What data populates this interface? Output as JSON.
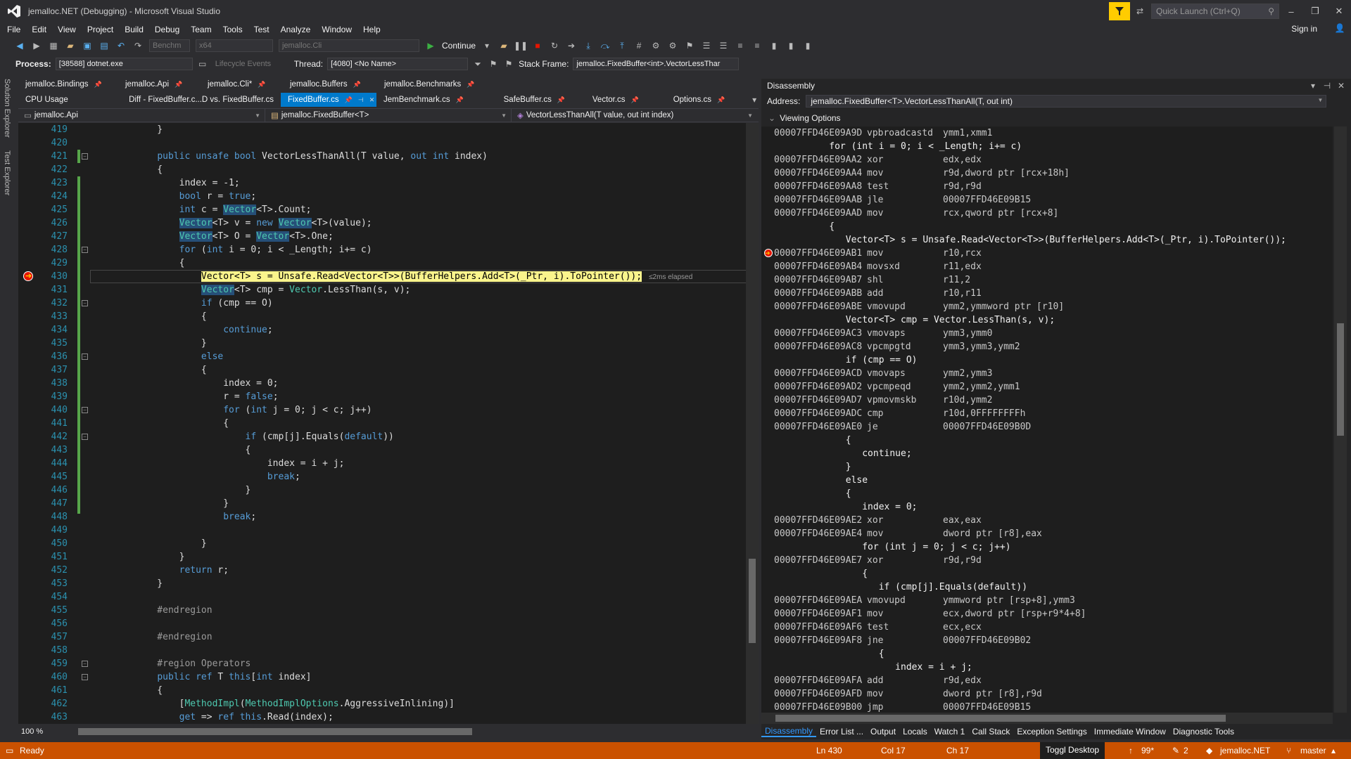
{
  "window": {
    "title": "jemalloc.NET (Debugging) - Microsoft Visual Studio",
    "quick_launch": "Quick Launch (Ctrl+Q)",
    "sign_in": "Sign in"
  },
  "menu": [
    "File",
    "Edit",
    "View",
    "Project",
    "Build",
    "Debug",
    "Team",
    "Tools",
    "Test",
    "Analyze",
    "Window",
    "Help"
  ],
  "toolbar": {
    "config": "Benchm",
    "platform": "x64",
    "startup_project": "jemalloc.Cli",
    "continue_label": "Continue"
  },
  "debug_location": {
    "process_label": "Process:",
    "process_value": "[38588] dotnet.exe",
    "lifecycle": "Lifecycle Events",
    "thread_label": "Thread:",
    "thread_value": "[4080] <No Name>",
    "stack_label": "Stack Frame:",
    "stack_value": "jemalloc.FixedBuffer<int>.VectorLessThar"
  },
  "side_tabs": [
    "Solution Explorer",
    "Test Explorer"
  ],
  "tabs_row1": [
    "jemalloc.Bindings",
    "jemalloc.Api",
    "jemalloc.Cli*",
    "jemalloc.Buffers",
    "jemalloc.Benchmarks"
  ],
  "tabs_row2": [
    "CPU Usage",
    "Diff - FixedBuffer.c...D vs. FixedBuffer.cs",
    "FixedBuffer.cs",
    "JemBenchmark.cs",
    "SafeBuffer.cs",
    "Vector.cs",
    "Options.cs"
  ],
  "nav": {
    "project": "jemalloc.Api",
    "type": "jemalloc.FixedBuffer<T>",
    "member": "VectorLessThanAll(T value, out int index)"
  },
  "editor": {
    "current_line": 430,
    "elapsed": "≤2ms elapsed",
    "zoom": "100 %",
    "lines": [
      {
        "n": "419",
        "t": "    }"
      },
      {
        "n": "420",
        "t": ""
      },
      {
        "n": "421",
        "t": "    public unsafe bool VectorLessThanAll(T value, out int index)"
      },
      {
        "n": "422",
        "t": "    {"
      },
      {
        "n": "423",
        "t": "        index = -1;"
      },
      {
        "n": "424",
        "t": "        bool r = true;"
      },
      {
        "n": "425",
        "t": "        int c = Vector<T>.Count;"
      },
      {
        "n": "426",
        "t": "        Vector<T> v = new Vector<T>(value);"
      },
      {
        "n": "427",
        "t": "        Vector<T> O = Vector<T>.One;"
      },
      {
        "n": "428",
        "t": "        for (int i = 0; i < _Length; i+= c)"
      },
      {
        "n": "429",
        "t": "        {"
      },
      {
        "n": "430",
        "t": "            Vector<T> s = Unsafe.Read<Vector<T>>(BufferHelpers.Add<T>(_Ptr, i).ToPointer());"
      },
      {
        "n": "431",
        "t": "            Vector<T> cmp = Vector.LessThan(s, v);"
      },
      {
        "n": "432",
        "t": "            if (cmp == O)"
      },
      {
        "n": "433",
        "t": "            {"
      },
      {
        "n": "434",
        "t": "                continue;"
      },
      {
        "n": "435",
        "t": "            }"
      },
      {
        "n": "436",
        "t": "            else"
      },
      {
        "n": "437",
        "t": "            {"
      },
      {
        "n": "438",
        "t": "                index = 0;"
      },
      {
        "n": "439",
        "t": "                r = false;"
      },
      {
        "n": "440",
        "t": "                for (int j = 0; j < c; j++)"
      },
      {
        "n": "441",
        "t": "                {"
      },
      {
        "n": "442",
        "t": "                    if (cmp[j].Equals(default))"
      },
      {
        "n": "443",
        "t": "                    {"
      },
      {
        "n": "444",
        "t": "                        index = i + j;"
      },
      {
        "n": "445",
        "t": "                        break;"
      },
      {
        "n": "446",
        "t": "                    }"
      },
      {
        "n": "447",
        "t": "                }"
      },
      {
        "n": "448",
        "t": "                break;"
      },
      {
        "n": "449",
        "t": ""
      },
      {
        "n": "450",
        "t": "            }"
      },
      {
        "n": "451",
        "t": "        }"
      },
      {
        "n": "452",
        "t": "        return r;"
      },
      {
        "n": "453",
        "t": "    }"
      },
      {
        "n": "454",
        "t": ""
      },
      {
        "n": "455",
        "t": "    #endregion"
      },
      {
        "n": "456",
        "t": ""
      },
      {
        "n": "457",
        "t": "    #endregion"
      },
      {
        "n": "458",
        "t": ""
      },
      {
        "n": "459",
        "t": "    #region Operators"
      },
      {
        "n": "460",
        "t": "    public ref T this[int index]"
      },
      {
        "n": "461",
        "t": "    {"
      },
      {
        "n": "462",
        "t": "        [MethodImpl(MethodImplOptions.AggressiveInlining)]"
      },
      {
        "n": "463",
        "t": "        get => ref this.Read(index);"
      }
    ]
  },
  "disassembly": {
    "panel_title": "Disassembly",
    "address_label": "Address:",
    "address_value": "jemalloc.FixedBuffer<T>.VectorLessThanAll(T, out int)",
    "viewing_options": "Viewing Options",
    "lines": [
      {
        "a": "00007FFD46E09A9D",
        "m": "vpbroadcastd",
        "o": "ymm1,xmm1"
      },
      {
        "s": "          for (int i = 0; i < _Length; i+= c)"
      },
      {
        "a": "00007FFD46E09AA2",
        "m": "xor",
        "o": "edx,edx"
      },
      {
        "a": "00007FFD46E09AA4",
        "m": "mov",
        "o": "r9d,dword ptr [rcx+18h]"
      },
      {
        "a": "00007FFD46E09AA8",
        "m": "test",
        "o": "r9d,r9d"
      },
      {
        "a": "00007FFD46E09AAB",
        "m": "jle",
        "o": "00007FFD46E09B15"
      },
      {
        "a": "00007FFD46E09AAD",
        "m": "mov",
        "o": "rcx,qword ptr [rcx+8]"
      },
      {
        "s": "          {"
      },
      {
        "s": "             Vector<T> s = Unsafe.Read<Vector<T>>(BufferHelpers.Add<T>(_Ptr, i).ToPointer());"
      },
      {
        "a": "00007FFD46E09AB1",
        "m": "mov",
        "o": "r10,rcx"
      },
      {
        "a": "00007FFD46E09AB4",
        "m": "movsxd",
        "o": "r11,edx"
      },
      {
        "a": "00007FFD46E09AB7",
        "m": "shl",
        "o": "r11,2"
      },
      {
        "a": "00007FFD46E09ABB",
        "m": "add",
        "o": "r10,r11"
      },
      {
        "a": "00007FFD46E09ABE",
        "m": "vmovupd",
        "o": "ymm2,ymmword ptr [r10]"
      },
      {
        "s": "             Vector<T> cmp = Vector.LessThan(s, v);"
      },
      {
        "a": "00007FFD46E09AC3",
        "m": "vmovaps",
        "o": "ymm3,ymm0"
      },
      {
        "a": "00007FFD46E09AC8",
        "m": "vpcmpgtd",
        "o": "ymm3,ymm3,ymm2"
      },
      {
        "s": "             if (cmp == O)"
      },
      {
        "a": "00007FFD46E09ACD",
        "m": "vmovaps",
        "o": "ymm2,ymm3"
      },
      {
        "a": "00007FFD46E09AD2",
        "m": "vpcmpeqd",
        "o": "ymm2,ymm2,ymm1"
      },
      {
        "a": "00007FFD46E09AD7",
        "m": "vpmovmskb",
        "o": "r10d,ymm2"
      },
      {
        "a": "00007FFD46E09ADC",
        "m": "cmp",
        "o": "r10d,0FFFFFFFFh"
      },
      {
        "a": "00007FFD46E09AE0",
        "m": "je",
        "o": "00007FFD46E09B0D"
      },
      {
        "s": "             {"
      },
      {
        "s": "                continue;"
      },
      {
        "s": "             }"
      },
      {
        "s": "             else"
      },
      {
        "s": "             {"
      },
      {
        "s": "                index = 0;"
      },
      {
        "a": "00007FFD46E09AE2",
        "m": "xor",
        "o": "eax,eax"
      },
      {
        "a": "00007FFD46E09AE4",
        "m": "mov",
        "o": "dword ptr [r8],eax"
      },
      {
        "s": "                for (int j = 0; j < c; j++)"
      },
      {
        "a": "00007FFD46E09AE7",
        "m": "xor",
        "o": "r9d,r9d"
      },
      {
        "s": "                {"
      },
      {
        "s": "                   if (cmp[j].Equals(default))"
      },
      {
        "a": "00007FFD46E09AEA",
        "m": "vmovupd",
        "o": "ymmword ptr [rsp+8],ymm3"
      },
      {
        "a": "00007FFD46E09AF1",
        "m": "mov",
        "o": "ecx,dword ptr [rsp+r9*4+8]"
      },
      {
        "a": "00007FFD46E09AF6",
        "m": "test",
        "o": "ecx,ecx"
      },
      {
        "a": "00007FFD46E09AF8",
        "m": "jne",
        "o": "00007FFD46E09B02"
      },
      {
        "s": "                   {"
      },
      {
        "s": "                      index = i + j;"
      },
      {
        "a": "00007FFD46E09AFA",
        "m": "add",
        "o": "r9d,edx"
      },
      {
        "a": "00007FFD46E09AFD",
        "m": "mov",
        "o": "dword ptr [r8],r9d"
      },
      {
        "a": "00007FFD46E09B00",
        "m": "jmp",
        "o": "00007FFD46E09B15"
      }
    ]
  },
  "bottom_tabs": [
    "Disassembly",
    "Error List ...",
    "Output",
    "Locals",
    "Watch 1",
    "Call Stack",
    "Exception Settings",
    "Immediate Window",
    "Diagnostic Tools"
  ],
  "status": {
    "state": "Ready",
    "ln": "Ln 430",
    "col": "Col 17",
    "ch": "Ch 17",
    "toggl": "Toggl Desktop",
    "up": "99*",
    "edits": "2",
    "repo": "jemalloc.NET",
    "branch": "master"
  },
  "colors": {
    "accent": "#007acc",
    "status": "#ca5100",
    "statement": "#faf48c"
  }
}
